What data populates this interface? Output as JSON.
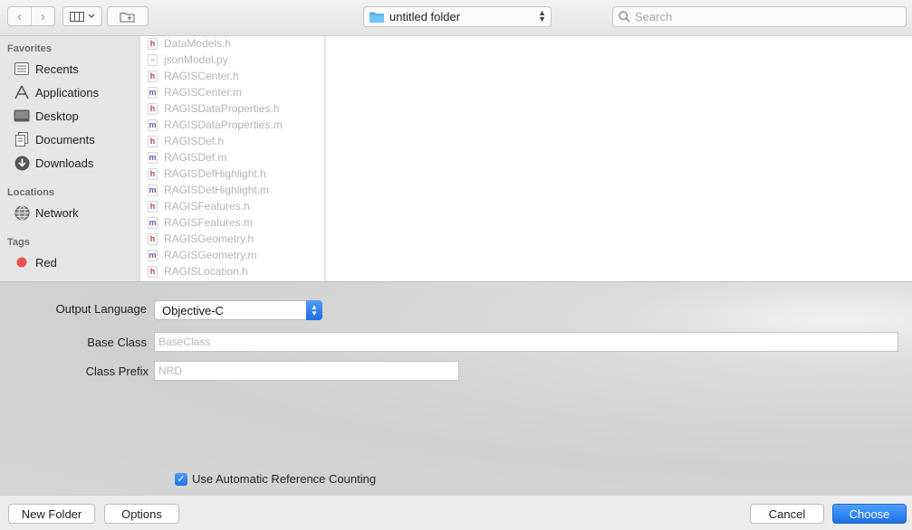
{
  "toolbar": {
    "back_glyph": "‹",
    "forward_glyph": "›",
    "location_label": "untitled folder",
    "search_placeholder": "Search"
  },
  "sidebar": {
    "favorites_header": "Favorites",
    "favorites": [
      {
        "label": "Recents",
        "icon": "recents-icon"
      },
      {
        "label": "Applications",
        "icon": "applications-icon"
      },
      {
        "label": "Desktop",
        "icon": "desktop-icon"
      },
      {
        "label": "Documents",
        "icon": "documents-icon"
      },
      {
        "label": "Downloads",
        "icon": "downloads-icon"
      }
    ],
    "locations_header": "Locations",
    "locations": [
      {
        "label": "Network",
        "icon": "network-icon"
      }
    ],
    "tags_header": "Tags",
    "tags": [
      {
        "label": "Red",
        "color": "#f0524f"
      }
    ]
  },
  "files": [
    {
      "name": "DataModels.h",
      "type": "h"
    },
    {
      "name": "jsonModel.py",
      "type": "py"
    },
    {
      "name": "RAGISCenter.h",
      "type": "h"
    },
    {
      "name": "RAGISCenter.m",
      "type": "m"
    },
    {
      "name": "RAGISDataProperties.h",
      "type": "h"
    },
    {
      "name": "RAGISDataProperties.m",
      "type": "m"
    },
    {
      "name": "RAGISDef.h",
      "type": "h"
    },
    {
      "name": "RAGISDef.m",
      "type": "m"
    },
    {
      "name": "RAGISDefHighlight.h",
      "type": "h"
    },
    {
      "name": "RAGISDefHighlight.m",
      "type": "m"
    },
    {
      "name": "RAGISFeatures.h",
      "type": "h"
    },
    {
      "name": "RAGISFeatures.m",
      "type": "m"
    },
    {
      "name": "RAGISGeometry.h",
      "type": "h"
    },
    {
      "name": "RAGISGeometry.m",
      "type": "m"
    },
    {
      "name": "RAGISLocation.h",
      "type": "h"
    }
  ],
  "accessory": {
    "output_language_label": "Output Language",
    "output_language_value": "Objective-C",
    "base_class_label": "Base Class",
    "base_class_placeholder": "BaseClass",
    "class_prefix_label": "Class Prefix",
    "class_prefix_placeholder": "NRD",
    "arc_label": "Use Automatic Reference Counting",
    "arc_checked": true
  },
  "buttons": {
    "new_folder": "New Folder",
    "options": "Options",
    "cancel": "Cancel",
    "choose": "Choose"
  },
  "colors": {
    "accent": "#1f6fe6",
    "tag_red": "#f0524f"
  }
}
